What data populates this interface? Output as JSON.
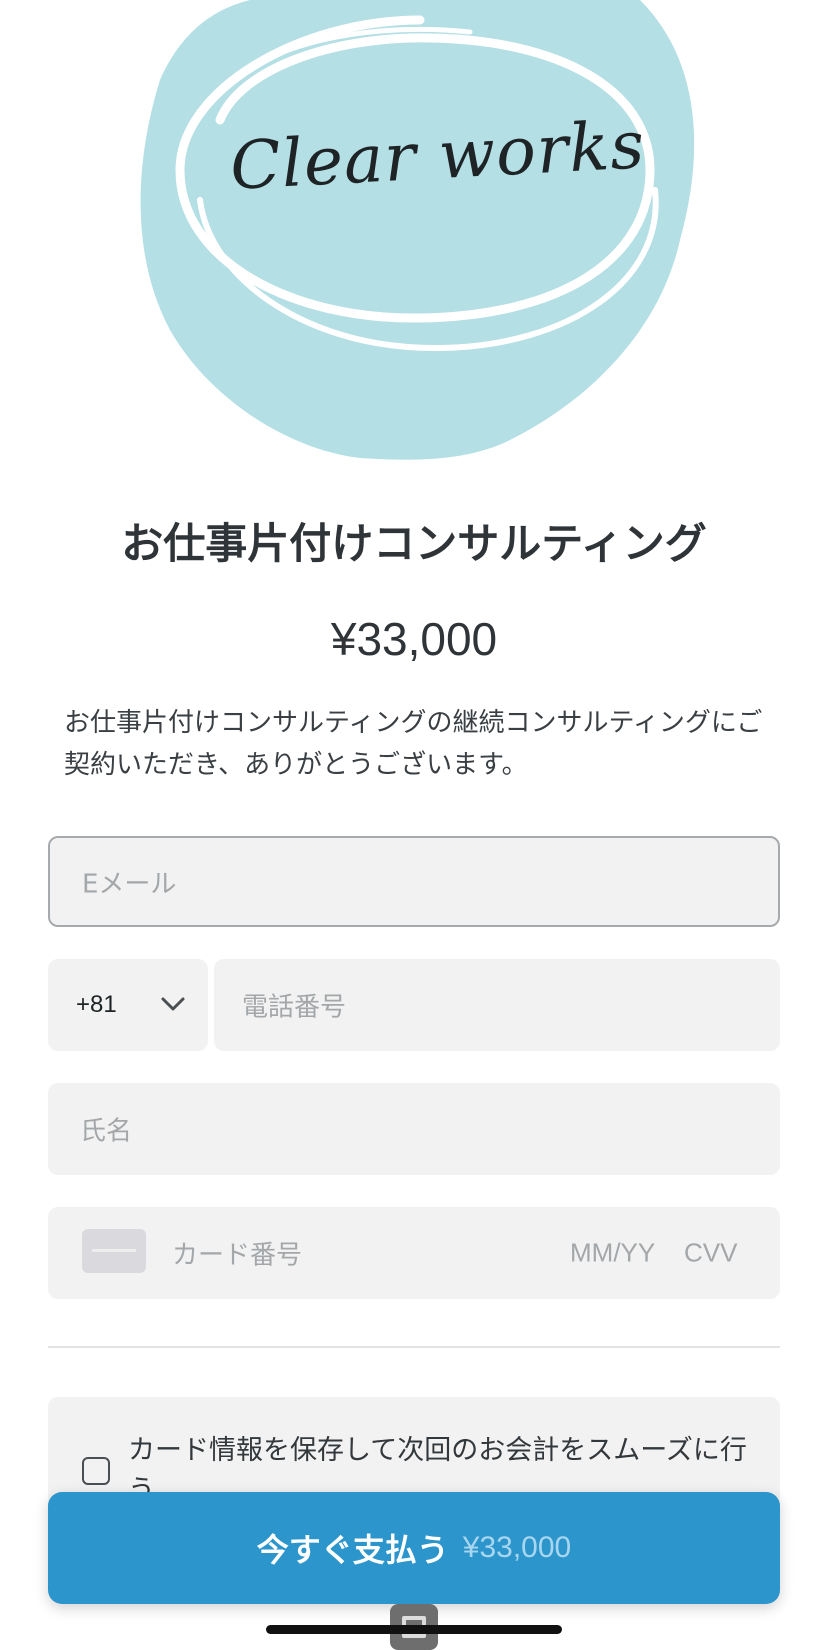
{
  "logo": {
    "text": "Clear works",
    "bg_color": "#b3dfe5"
  },
  "product": {
    "title": "お仕事片付けコンサルティング",
    "price": "¥33,000",
    "description": "お仕事片付けコンサルティングの継続コンサルティングにご契約いただき、ありがとうございます。"
  },
  "form": {
    "email_placeholder": "Eメール",
    "country_code": "+81",
    "phone_placeholder": "電話番号",
    "name_placeholder": "氏名",
    "card_placeholder": "カード番号",
    "expiry_placeholder": "MM/YY",
    "cvv_placeholder": "CVV",
    "save_card_label": "カード情報を保存して次回のお会計をスムーズに行う",
    "save_card_checked": false
  },
  "pay_button": {
    "label": "今すぐ支払う",
    "amount": "¥33,000",
    "color": "#2b95cc"
  }
}
